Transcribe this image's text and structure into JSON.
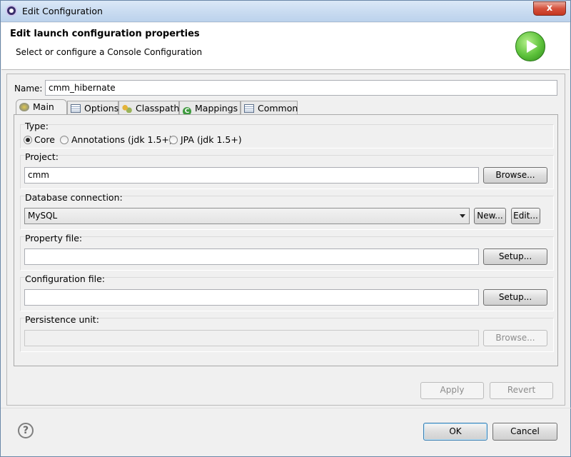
{
  "window": {
    "title": "Edit Configuration",
    "close_glyph": "x"
  },
  "header": {
    "title": "Edit launch configuration properties",
    "subtitle": "Select or configure a Console Configuration",
    "icon": "run-icon"
  },
  "name": {
    "label": "Name:",
    "value": "cmm_hibernate"
  },
  "tabs": [
    {
      "label": "Main",
      "icon": "main-icon",
      "active": true
    },
    {
      "label": "Options",
      "icon": "options-icon",
      "active": false
    },
    {
      "label": "Classpath",
      "icon": "classpath-icon",
      "active": false
    },
    {
      "label": "Mappings",
      "icon": "mappings-icon",
      "icon_glyph": "C",
      "active": false
    },
    {
      "label": "Common",
      "icon": "common-icon",
      "active": false
    }
  ],
  "type": {
    "label": "Type:",
    "options": [
      {
        "label": "Core",
        "checked": true
      },
      {
        "label": "Annotations (jdk 1.5+)",
        "checked": false
      },
      {
        "label": "JPA (jdk 1.5+)",
        "checked": false
      }
    ]
  },
  "project": {
    "label": "Project:",
    "value": "cmm",
    "browse_label": "Browse..."
  },
  "database": {
    "label": "Database connection:",
    "selected": "MySQL",
    "new_label": "New...",
    "edit_label": "Edit..."
  },
  "property_file": {
    "label": "Property file:",
    "value": "",
    "setup_label": "Setup..."
  },
  "configuration_file": {
    "label": "Configuration file:",
    "value": "",
    "setup_label": "Setup..."
  },
  "persistence": {
    "label": "Persistence unit:",
    "value": "",
    "browse_label": "Browse..."
  },
  "actions": {
    "apply_label": "Apply",
    "revert_label": "Revert"
  },
  "footer": {
    "help_glyph": "?",
    "ok_label": "OK",
    "cancel_label": "Cancel"
  }
}
